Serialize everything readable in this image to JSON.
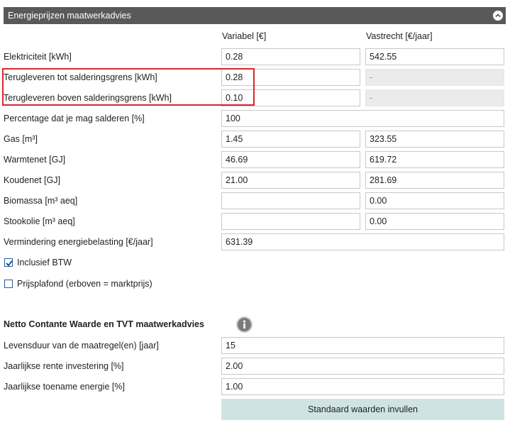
{
  "panel": {
    "title": "Energieprijzen maatwerkadvies"
  },
  "columns": {
    "variable": "Variabel [€]",
    "fixed": "Vastrecht [€/jaar]"
  },
  "rows": {
    "elektriciteit": {
      "label": "Elektriciteit [kWh]",
      "variable": "0.28",
      "fixed": "542.55"
    },
    "terug_tot": {
      "label": "Terugleveren tot salderingsgrens [kWh]",
      "variable": "0.28",
      "fixed": "-"
    },
    "terug_boven": {
      "label": "Terugleveren boven salderingsgrens [kWh]",
      "variable": "0.10",
      "fixed": "-"
    },
    "percentage": {
      "label": "Percentage dat je mag salderen [%]",
      "value": "100"
    },
    "gas": {
      "label": "Gas [m³]",
      "variable": "1.45",
      "fixed": "323.55"
    },
    "warmtenet": {
      "label": "Warmtenet [GJ]",
      "variable": "46.69",
      "fixed": "619.72"
    },
    "koudenet": {
      "label": "Koudenet [GJ]",
      "variable": "21.00",
      "fixed": "281.69"
    },
    "biomassa": {
      "label": "Biomassa [m³ aeq]",
      "variable": "",
      "fixed": "0.00"
    },
    "stookolie": {
      "label": "Stookolie [m³ aeq]",
      "variable": "",
      "fixed": "0.00"
    },
    "vermindering": {
      "label": "Vermindering energiebelasting [€/jaar]",
      "value": "631.39"
    }
  },
  "checkboxes": {
    "btw": {
      "label": "Inclusief BTW",
      "checked": true
    },
    "plafond": {
      "label": "Prijsplafond (erboven = marktprijs)",
      "checked": false
    }
  },
  "ncw": {
    "title": "Netto Contante Waarde en TVT maatwerkadvies",
    "levensduur": {
      "label": "Levensduur van de maatregel(en) [jaar]",
      "value": "15"
    },
    "rente": {
      "label": "Jaarlijkse rente investering [%]",
      "value": "2.00"
    },
    "toename": {
      "label": "Jaarlijkse toename energie [%]",
      "value": "1.00"
    },
    "button_label": "Standaard waarden invullen"
  },
  "colors": {
    "header_bg": "#58595b",
    "highlight": "#d9262c",
    "button_bg": "#cfe3e3",
    "checkbox": "#1e5bb0"
  },
  "icons": {
    "collapse": "chevron-up-icon",
    "info": "info-icon",
    "check": "checkmark-icon"
  }
}
